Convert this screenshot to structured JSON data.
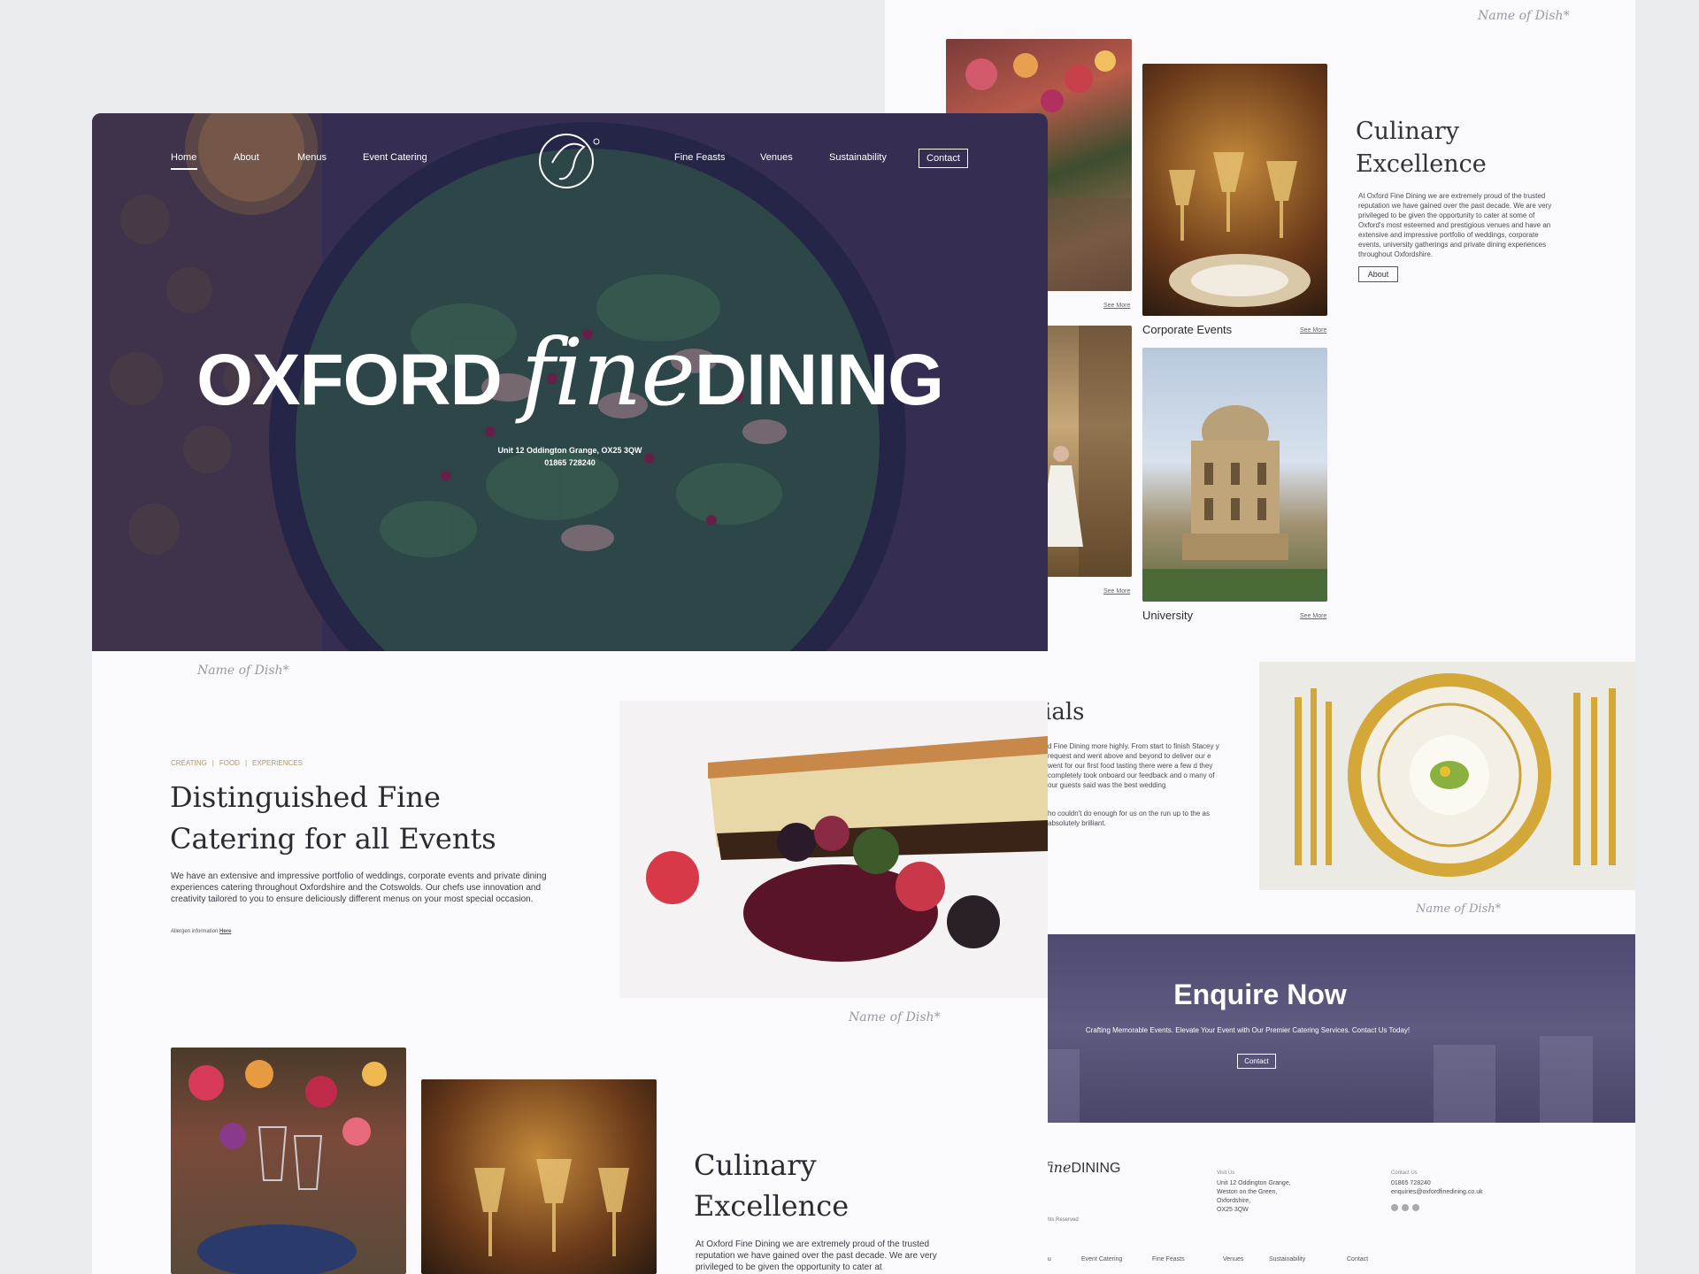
{
  "back": {
    "top_caption": "Name of Dish*",
    "culinary_title_l1": "Culinary",
    "culinary_title_l2": "Excellence",
    "culinary_body": "At Oxford Fine Dining we are extremely proud of the trusted reputation we have gained over the past decade. We are very privileged to be given the opportunity to cater at some of Oxford's most esteemed and prestigious venues and have an extensive and impressive portfolio of weddings, corporate events, university gatherings and private dining experiences throughout Oxfordshire.",
    "about_button": "About",
    "see_more": "See More",
    "corporate_label": "Corporate Events",
    "university_label": "University",
    "testimonials_fragment": "ials",
    "testimonial_p1": "d Fine Dining more highly. From start to finish Stacey y request and went above and beyond to deliver our e went for our first food tasting there were a few d they completely took onboard our feedback and o many of our guests said was the best wedding",
    "testimonial_p2": "ho couldn't do enough for us on the run up to the as absolutely brilliant.",
    "plate_caption": "Name of Dish*",
    "enquire_title": "Enquire Now",
    "enquire_sub": "Crafting Memorable Events. Elevate Your Event with Our Premier Catering Services. Contact Us Today!",
    "enquire_button": "Contact",
    "footer_logo_script": "fine",
    "footer_logo_text": "DINING",
    "footer_rights": "ghts Reserved",
    "footer_visit_label": "Visit Us",
    "footer_address": [
      "Unit 12 Oddington Grange,",
      "Weston on the Green,",
      "Oxfordshire,",
      "OX25 3QW"
    ],
    "footer_contact_label": "Contact Us",
    "footer_phone": "01865 728240",
    "footer_email": "enquiries@oxfordfinedining.co.uk",
    "footer_nav": [
      "nu",
      "Event Catering",
      "Fine Feasts",
      "Venues",
      "Sustainability",
      "Contact"
    ]
  },
  "front": {
    "nav_left": [
      "Home",
      "About",
      "Menus",
      "Event Catering"
    ],
    "nav_right": [
      "Fine Feasts",
      "Venues",
      "Sustainability"
    ],
    "nav_contact": "Contact",
    "hero_title_left": "OXFORD",
    "hero_title_script": "fine",
    "hero_title_right": "DINING",
    "hero_address": "Unit 12 Oddington Grange, OX25 3QW",
    "hero_phone": "01865 728240",
    "hero_caption": "Name of Dish*",
    "eyebrow": [
      "CREATING",
      "FOOD",
      "EXPERIENCES"
    ],
    "intro_title_l1": "Distinguished Fine",
    "intro_title_l2": "Catering for all Events",
    "intro_body": "We have an extensive and impressive portfolio of weddings, corporate events and private dining experiences catering throughout Oxfordshire and the Cotswolds. Our chefs use innovation and creativity tailored to you to ensure deliciously different menus on your most special occasion.",
    "allergen_text": "Allergen information",
    "allergen_link": "Here",
    "dessert_caption": "Name of Dish*",
    "culinary_title_l1": "Culinary",
    "culinary_title_l2": "Excellence",
    "culinary_body": "At Oxford Fine Dining we are extremely proud of the trusted reputation we have gained over the past decade. We are very privileged to be given the opportunity to cater at"
  },
  "colors": {
    "overlay": "#3a3566",
    "accent_gold": "#c9a23a",
    "page_bg": "#ebecf0"
  }
}
